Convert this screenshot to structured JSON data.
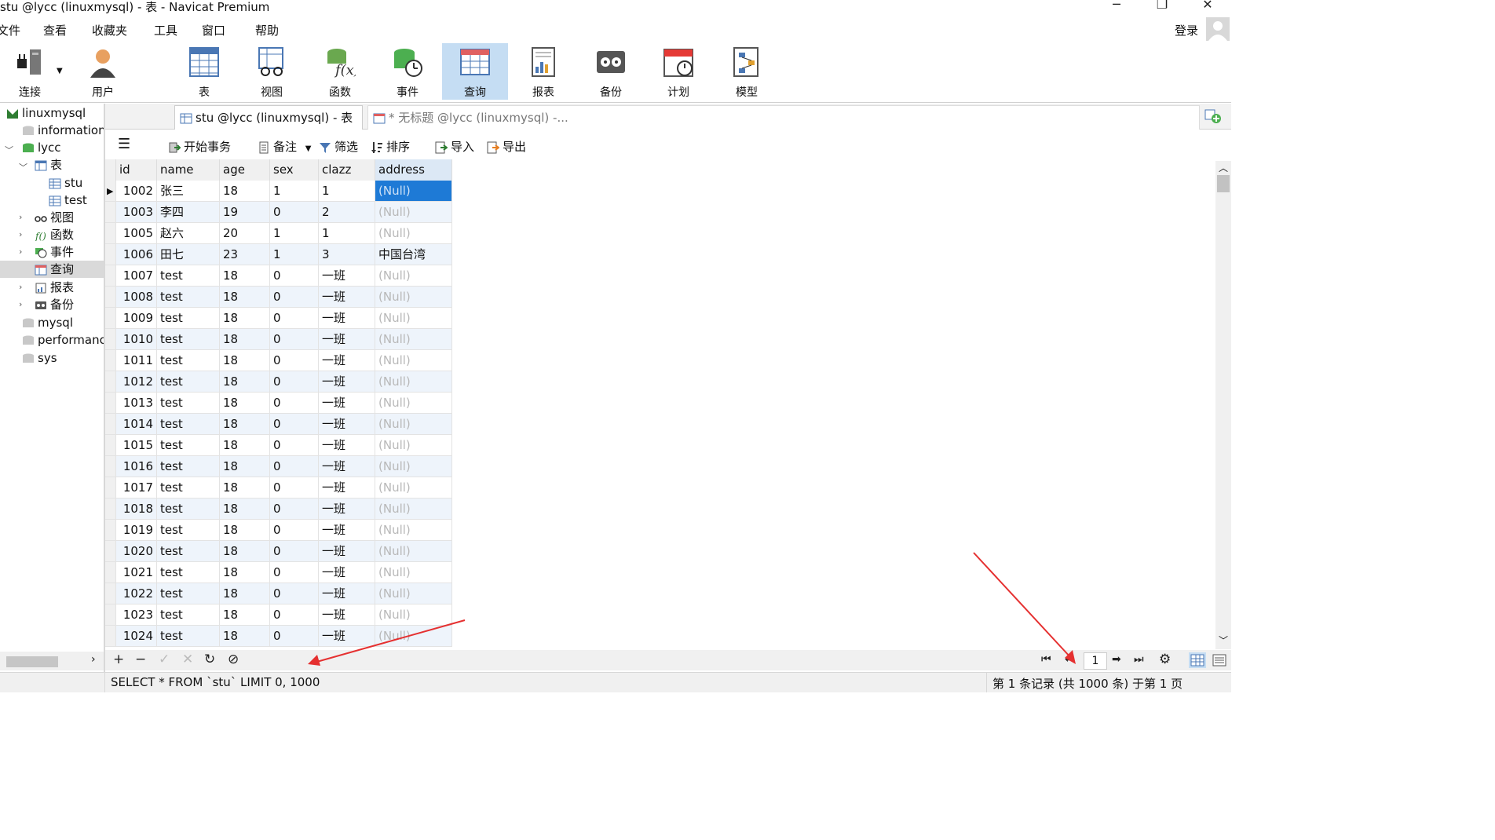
{
  "window": {
    "title": "stu @lycc (linuxmysql) - 表 - Navicat Premium",
    "minimize": "─",
    "restore": "❐",
    "close": "✕"
  },
  "menubar": {
    "items": [
      "文件",
      "查看",
      "收藏夹",
      "工具",
      "窗口",
      "帮助"
    ],
    "login": "登录"
  },
  "ribbon": {
    "buttons": [
      {
        "label": "连接",
        "icon": "connection-icon"
      },
      {
        "label": "用户",
        "icon": "user-icon"
      },
      {
        "label": "表",
        "icon": "table-icon"
      },
      {
        "label": "视图",
        "icon": "view-icon"
      },
      {
        "label": "函数",
        "icon": "function-icon"
      },
      {
        "label": "事件",
        "icon": "event-icon"
      },
      {
        "label": "查询",
        "icon": "query-icon"
      },
      {
        "label": "报表",
        "icon": "report-icon"
      },
      {
        "label": "备份",
        "icon": "backup-icon"
      },
      {
        "label": "计划",
        "icon": "schedule-icon"
      },
      {
        "label": "模型",
        "icon": "model-icon"
      }
    ],
    "active": "查询"
  },
  "sidebar": {
    "nodes": [
      {
        "label": "linuxmysql",
        "icon": "connection-icon"
      },
      {
        "label": "information_schema",
        "icon": "database-icon"
      },
      {
        "label": "lycc",
        "icon": "database-icon"
      },
      {
        "label": "表",
        "icon": "table-icon"
      },
      {
        "label": "stu",
        "icon": "table-icon"
      },
      {
        "label": "test",
        "icon": "table-icon"
      },
      {
        "label": "视图",
        "icon": "view-icon"
      },
      {
        "label": "函数",
        "icon": "function-icon"
      },
      {
        "label": "事件",
        "icon": "event-icon"
      },
      {
        "label": "查询",
        "icon": "query-icon"
      },
      {
        "label": "报表",
        "icon": "report-icon"
      },
      {
        "label": "备份",
        "icon": "backup-icon"
      },
      {
        "label": "mysql",
        "icon": "database-icon"
      },
      {
        "label": "performance_schema",
        "icon": "database-icon"
      },
      {
        "label": "sys",
        "icon": "database-icon"
      }
    ]
  },
  "tabs": [
    {
      "label": "stu @lycc (linuxmysql) - 表",
      "active": true
    },
    {
      "label": "* 无标题 @lycc (linuxmysql) -...",
      "active": false
    }
  ],
  "toolbar": {
    "begin_tx": "开始事务",
    "memo": "备注",
    "filter": "筛选",
    "sort": "排序",
    "import": "导入",
    "export": "导出"
  },
  "grid": {
    "columns": [
      "id",
      "name",
      "age",
      "sex",
      "clazz",
      "address"
    ],
    "rows": [
      [
        "1002",
        "张三",
        "18",
        "1",
        "1",
        "(Null)"
      ],
      [
        "1003",
        "李四",
        "19",
        "0",
        "2",
        "(Null)"
      ],
      [
        "1005",
        "赵六",
        "20",
        "1",
        "1",
        "(Null)"
      ],
      [
        "1006",
        "田七",
        "23",
        "1",
        "3",
        "中国台湾"
      ],
      [
        "1007",
        "test",
        "18",
        "0",
        "一班",
        "(Null)"
      ],
      [
        "1008",
        "test",
        "18",
        "0",
        "一班",
        "(Null)"
      ],
      [
        "1009",
        "test",
        "18",
        "0",
        "一班",
        "(Null)"
      ],
      [
        "1010",
        "test",
        "18",
        "0",
        "一班",
        "(Null)"
      ],
      [
        "1011",
        "test",
        "18",
        "0",
        "一班",
        "(Null)"
      ],
      [
        "1012",
        "test",
        "18",
        "0",
        "一班",
        "(Null)"
      ],
      [
        "1013",
        "test",
        "18",
        "0",
        "一班",
        "(Null)"
      ],
      [
        "1014",
        "test",
        "18",
        "0",
        "一班",
        "(Null)"
      ],
      [
        "1015",
        "test",
        "18",
        "0",
        "一班",
        "(Null)"
      ],
      [
        "1016",
        "test",
        "18",
        "0",
        "一班",
        "(Null)"
      ],
      [
        "1017",
        "test",
        "18",
        "0",
        "一班",
        "(Null)"
      ],
      [
        "1018",
        "test",
        "18",
        "0",
        "一班",
        "(Null)"
      ],
      [
        "1019",
        "test",
        "18",
        "0",
        "一班",
        "(Null)"
      ],
      [
        "1020",
        "test",
        "18",
        "0",
        "一班",
        "(Null)"
      ],
      [
        "1021",
        "test",
        "18",
        "0",
        "一班",
        "(Null)"
      ],
      [
        "1022",
        "test",
        "18",
        "0",
        "一班",
        "(Null)"
      ],
      [
        "1023",
        "test",
        "18",
        "0",
        "一班",
        "(Null)"
      ],
      [
        "1024",
        "test",
        "18",
        "0",
        "一班",
        "(Null)"
      ]
    ],
    "selected_row": 0,
    "selected_col": 5
  },
  "bottom": {
    "add": "+",
    "delete": "−",
    "apply": "✓",
    "cancel": "✕",
    "refresh": "↻",
    "stop": "⊘",
    "first": "⏮",
    "prev": "⬅",
    "page": "1",
    "next": "➡",
    "last": "⏭",
    "settings": "⚙"
  },
  "status": {
    "sql": "SELECT * FROM `stu` LIMIT 0, 1000",
    "records": "第 1 条记录 (共 1000 条) 于第 1 页"
  },
  "colors": {
    "selection": "#1e7ad6",
    "active_ribbon": "#c5ddf3",
    "annotation_arrow": "#e53030",
    "alt_row": "#eef4fb"
  }
}
